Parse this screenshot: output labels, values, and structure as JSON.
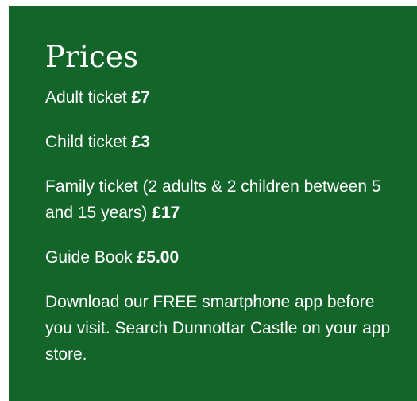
{
  "prices": {
    "title": "Prices",
    "items": [
      {
        "label": "Adult ticket",
        "price": "£7"
      },
      {
        "label": "Child ticket",
        "price": "£3"
      },
      {
        "label": "Family ticket (2 adults & 2 children between 5 and 15 years)",
        "price": "£17"
      },
      {
        "label": "Guide Book",
        "price": "£5.00"
      }
    ],
    "note": "Download our FREE smartphone app before you visit. Search Dunnottar Castle on your app store."
  },
  "colors": {
    "panel_background": "#13652a",
    "text": "#ffffff"
  }
}
